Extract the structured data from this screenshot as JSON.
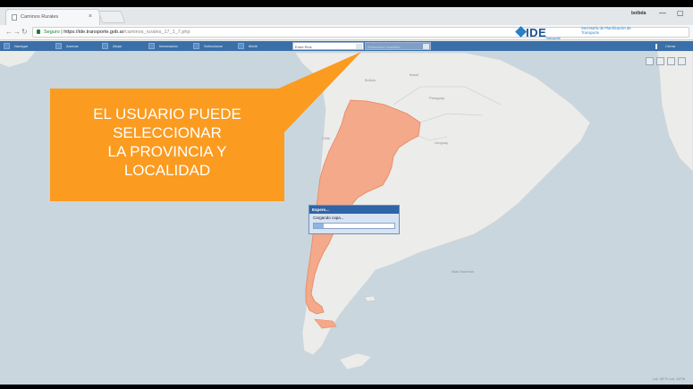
{
  "browser": {
    "tab_title": "Caminos Rurales",
    "tab_close": "×",
    "user_label": "bolbda",
    "win_min": "—",
    "win_max": "▢",
    "url_secure": "Seguro",
    "url_host": "https://ide.transporte.gob.ar",
    "url_path": "/caminos_rurales_17_1_7.php"
  },
  "brand": {
    "logo": "IDE",
    "logo_sub": "Transporte",
    "secretaria": "Secretaría de Planificación de Transporte"
  },
  "toolbar": {
    "buttons": [
      "Navegar",
      "Acercar",
      "Alejar",
      "Información",
      "Seleccionar",
      "Medir"
    ],
    "province_select": "Entre Rios",
    "locality_select": "Seleccione localidad",
    "close_label": "Cerrar"
  },
  "map": {
    "labels": [
      "Brasil",
      "Bolivia",
      "Paraguay",
      "Uruguay",
      "Chile",
      "Islas Malvinas"
    ],
    "scale_text": "Lat: 35°S Lon: 63°W"
  },
  "callout": {
    "lines": [
      "EL USUARIO PUEDE",
      "SELECCIONAR",
      "LA PROVINCIA Y",
      "LOCALIDAD"
    ]
  },
  "wait_dialog": {
    "title": "Espere...",
    "message": "Cargando capa...",
    "progress": 0.12
  }
}
